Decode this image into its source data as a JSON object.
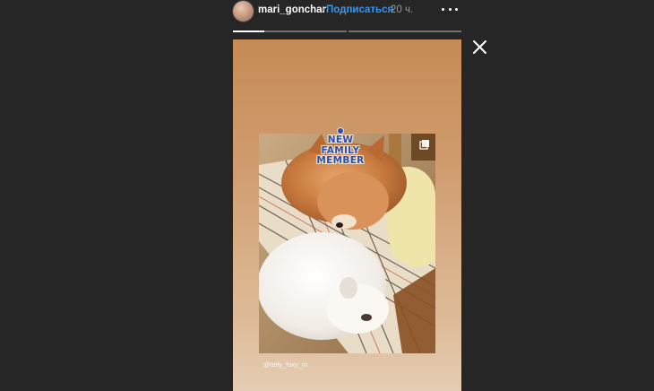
{
  "header": {
    "username": "mari_gonchar",
    "separator": "•",
    "follow_label": "Подписаться",
    "time_ago": "20 ч."
  },
  "progress": {
    "segments": [
      0.28,
      0.0
    ]
  },
  "story": {
    "sticker_lines": [
      "NEW",
      "FAMILY",
      "MEMBER"
    ],
    "mention": "@telly_foxy_m"
  },
  "colors": {
    "background": "#262626",
    "follow": "#3897f0",
    "sticker_text": "#2a4fb0"
  },
  "icons": {
    "more": "more-horizontal-icon",
    "close": "close-icon",
    "multi_photo": "multiple-photos-icon"
  }
}
